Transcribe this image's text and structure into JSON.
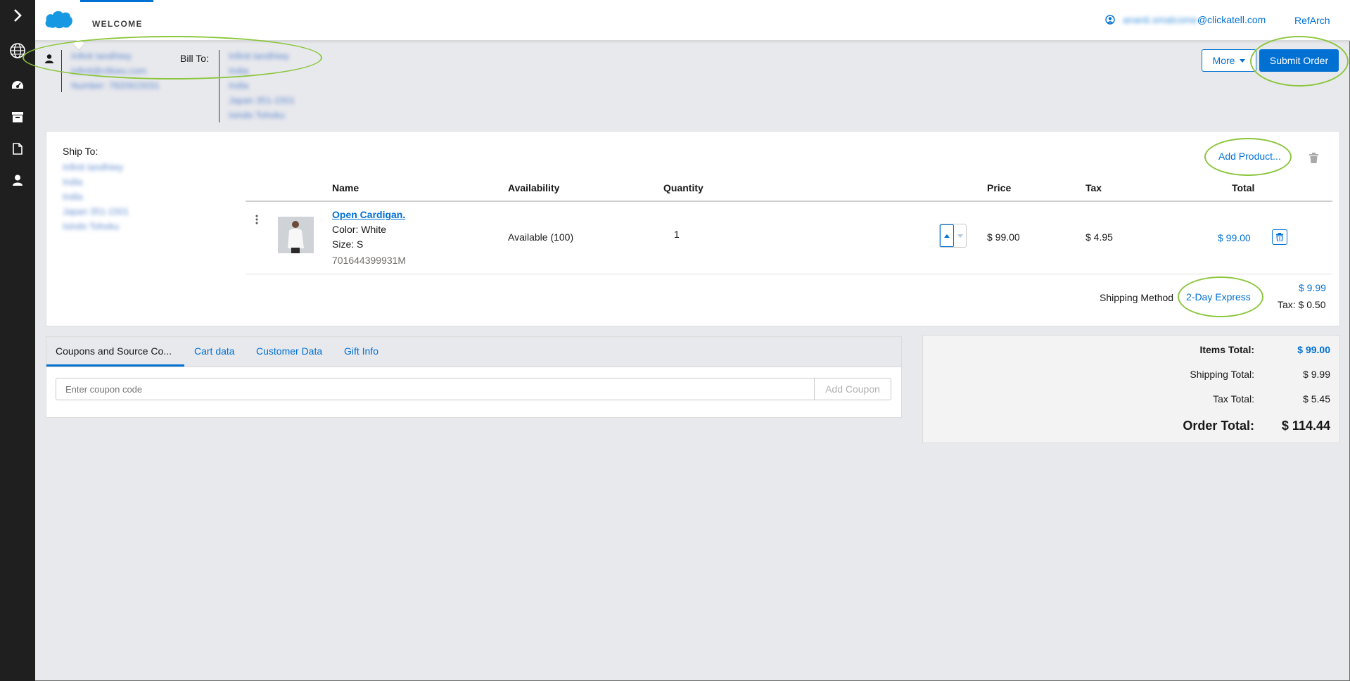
{
  "header": {
    "tab_label": "WELCOME",
    "user_email_suffix": "@clickatell.com",
    "user_email_hidden": "ananti.smalcome",
    "site_name": "RefArch"
  },
  "customer": {
    "lines": [
      "Infinit Iandhiwy",
      "infinit@clikwu.com",
      "Number: 7820915031"
    ]
  },
  "bill_to": {
    "label": "Bill To:",
    "lines": [
      "Infinit Iandhiwy",
      "India",
      "India",
      "Japan 351-1501",
      "Isindo Tohoku"
    ]
  },
  "actions": {
    "more_label": "More",
    "submit_label": "Submit Order"
  },
  "ship_to": {
    "label": "Ship To:",
    "lines": [
      "Infinit Iandhiwy",
      "India",
      "India",
      "Japan 351-1501",
      "Isindo Tohoku"
    ]
  },
  "cart": {
    "add_product_label": "Add Product...",
    "columns": {
      "name": "Name",
      "availability": "Availability",
      "quantity": "Quantity",
      "price": "Price",
      "tax": "Tax",
      "total": "Total"
    },
    "item": {
      "name": "Open Cardigan.",
      "color": "Color: White",
      "size": "Size: S",
      "sku": "701644399931M",
      "availability": "Available (100)",
      "quantity": "1",
      "price": "$ 99.00",
      "tax": "$ 4.95",
      "total": "$ 99.00"
    },
    "shipping": {
      "label": "Shipping Method",
      "method": "2-Day Express",
      "price": "$ 9.99",
      "tax": "Tax: $ 0.50"
    }
  },
  "tabs": {
    "items": [
      "Coupons and Source Co...",
      "Cart data",
      "Customer Data",
      "Gift Info"
    ],
    "coupon_placeholder": "Enter coupon code",
    "add_coupon_label": "Add Coupon"
  },
  "totals": {
    "items_label": "Items Total:",
    "items_value": "$ 99.00",
    "shipping_label": "Shipping Total:",
    "shipping_value": "$ 9.99",
    "tax_label": "Tax Total:",
    "tax_value": "$ 5.45",
    "order_label": "Order Total:",
    "order_value": "$ 114.44"
  },
  "colors": {
    "accent": "#0070d2",
    "highlight": "#8dc63f",
    "rail": "#1f1f1f",
    "page_bg": "#e8e9ed"
  },
  "icons": [
    "chevron-right-icon",
    "globe-icon",
    "dashboard-icon",
    "archive-icon",
    "document-icon",
    "person-icon",
    "cloud-logo",
    "user-circle-icon",
    "kebab-menu-icon",
    "trash-icon"
  ]
}
